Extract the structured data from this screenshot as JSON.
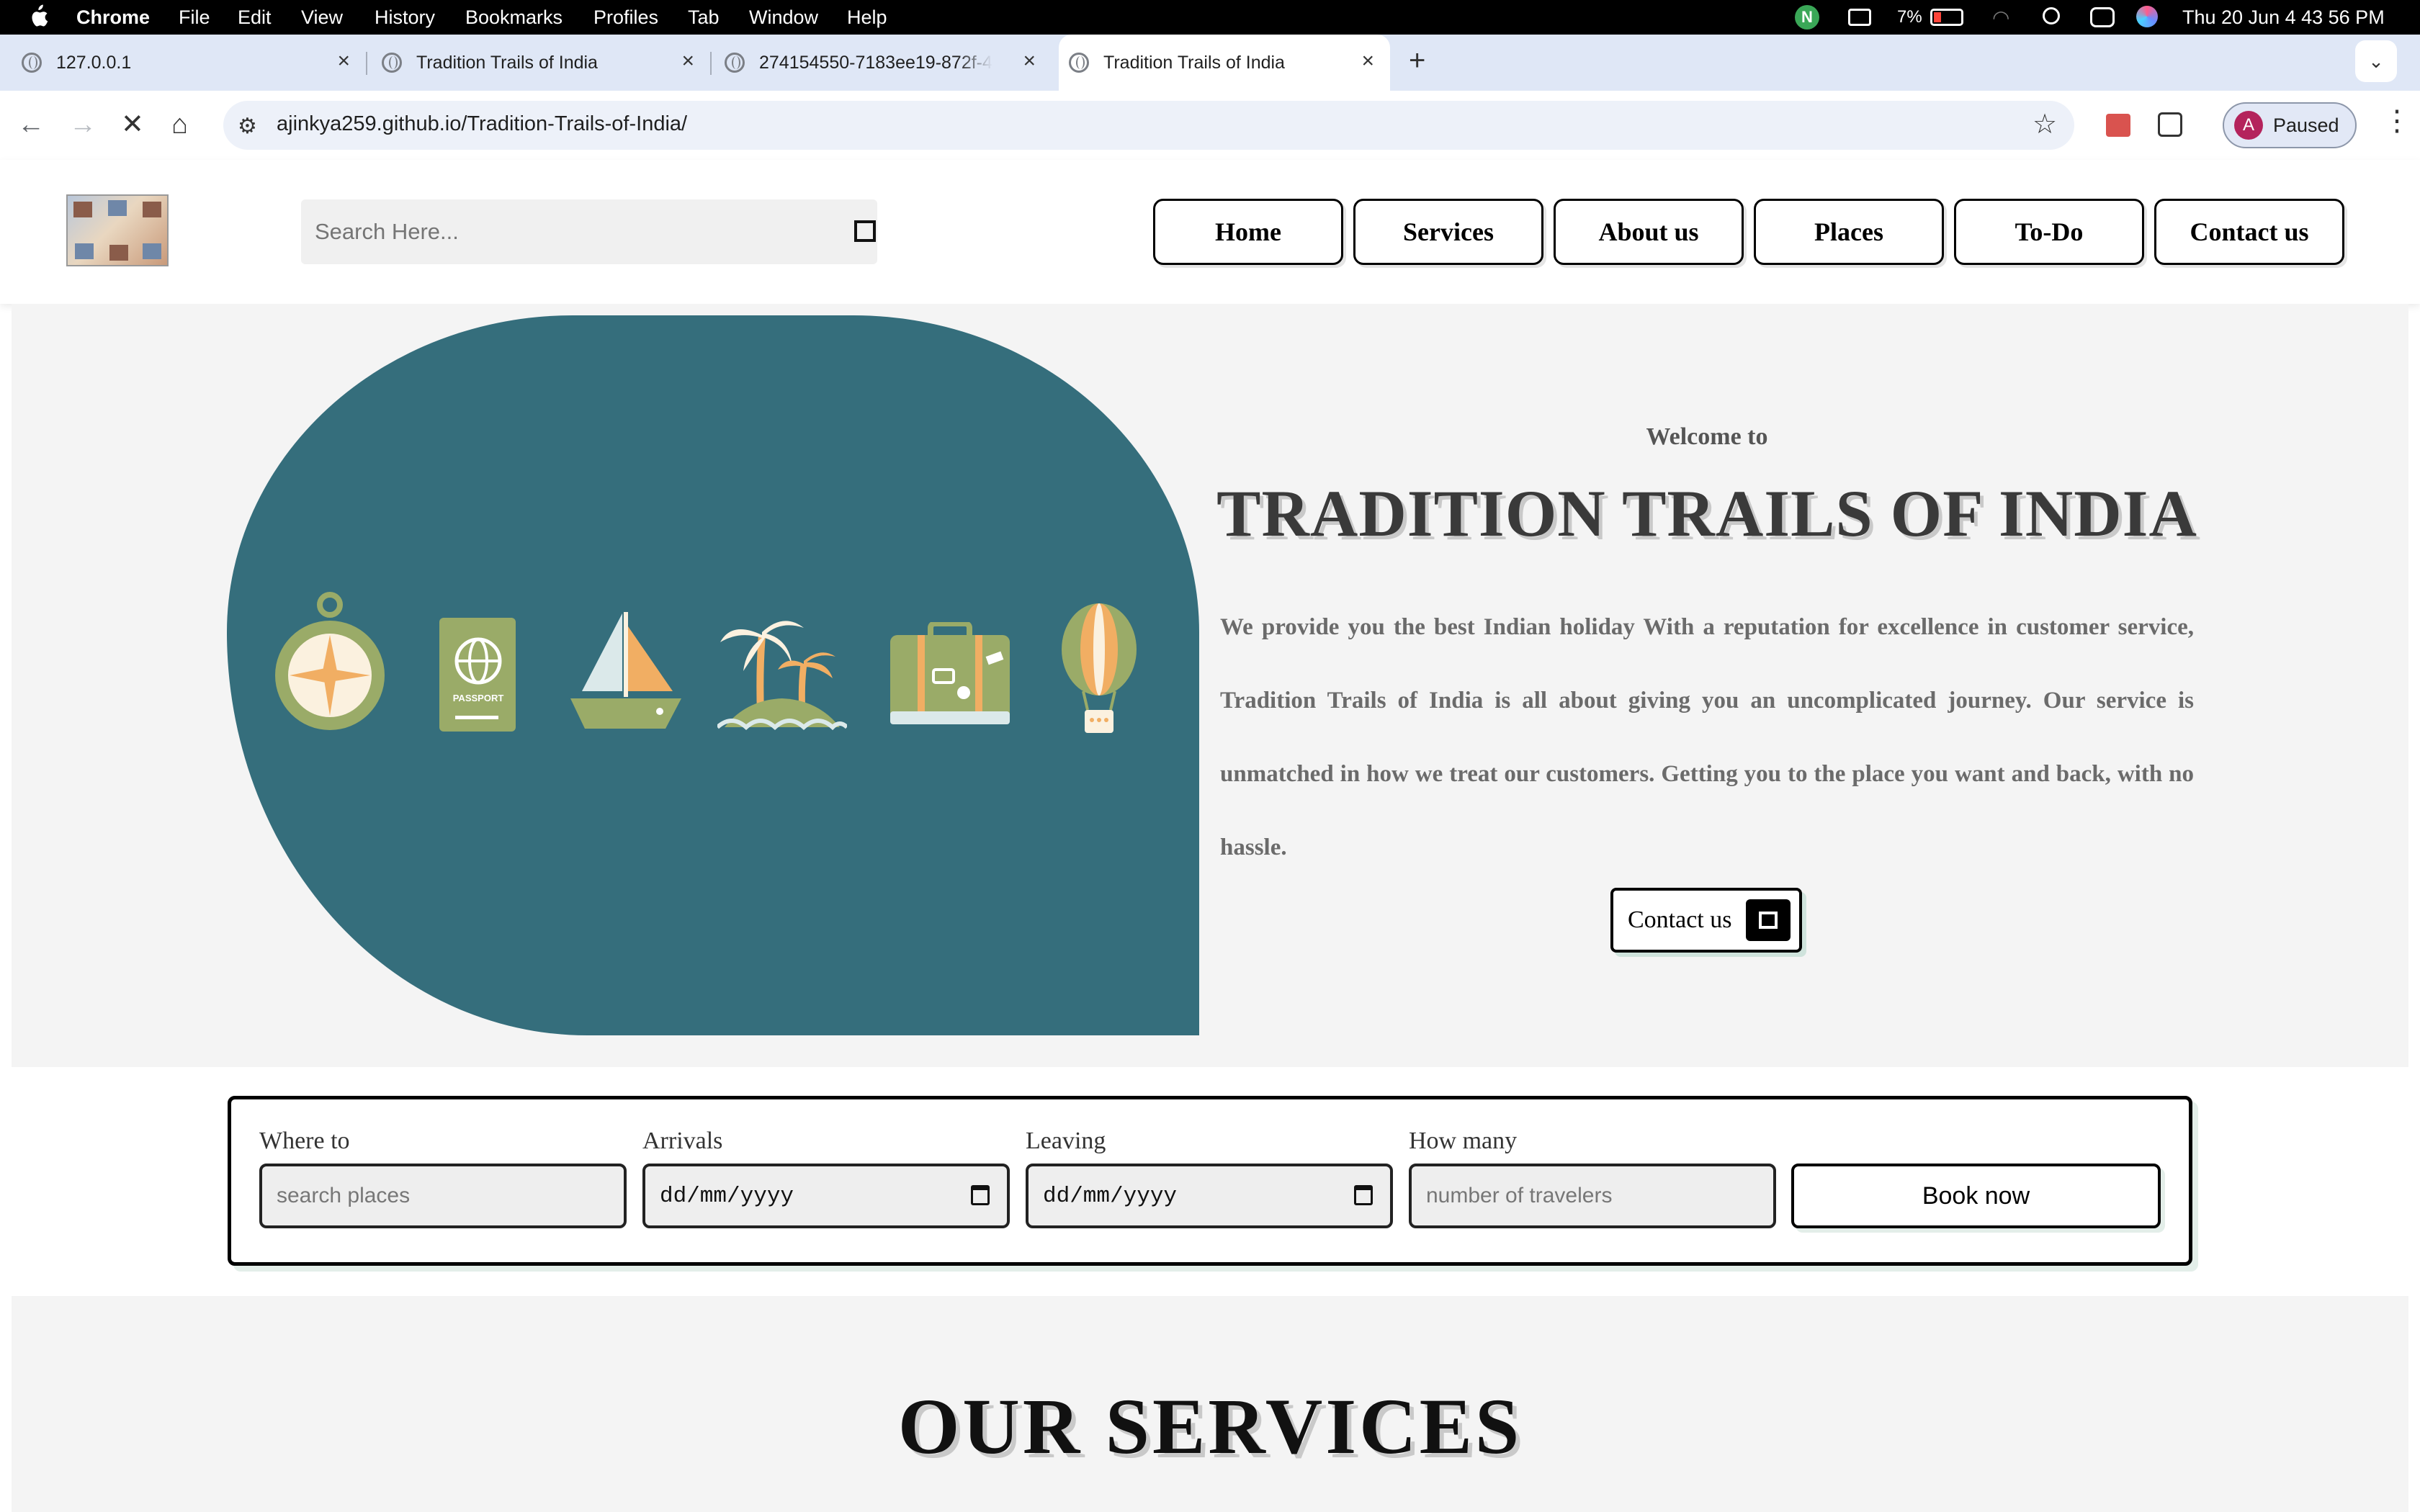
{
  "menubar": {
    "app": "Chrome",
    "items": [
      "File",
      "Edit",
      "View",
      "History",
      "Bookmarks",
      "Profiles",
      "Tab",
      "Window",
      "Help"
    ],
    "battery": "7%",
    "datetime": "Thu 20 Jun  4 43 56 PM"
  },
  "tabs": [
    {
      "title": "127.0.0.1"
    },
    {
      "title": "Tradition Trails of India"
    },
    {
      "title": "274154550-7183ee19-872f-4"
    },
    {
      "title": "Tradition Trails of India"
    }
  ],
  "toolbar": {
    "url": "ajinkya259.github.io/Tradition-Trails-of-India/",
    "profile_initial": "A",
    "profile_status": "Paused"
  },
  "header": {
    "search_placeholder": "Search Here...",
    "nav": [
      "Home",
      "Services",
      "About us",
      "Places",
      "To-Do",
      "Contact us"
    ]
  },
  "hero": {
    "welcome": "Welcome to",
    "title": "TRADITION TRAILS OF INDIA",
    "text": "We provide you the best Indian holiday With a reputation for excellence in customer service, Tradition Trails of India is all about giving you an uncomplicated journey. Our service is unmatched in how we treat our customers. Getting you to the place you want and back, with no hassle.",
    "cta": "Contact us",
    "passport_label": "PASSPORT",
    "icons": [
      "compass-icon",
      "passport-icon",
      "sailboat-icon",
      "island-icon",
      "suitcase-icon",
      "hot-air-balloon-icon"
    ],
    "colors": {
      "blob": "#356e7c",
      "green": "#9aab68",
      "orange": "#f1ae63"
    }
  },
  "booking": {
    "where_label": "Where to",
    "where_placeholder": "search places",
    "arrivals_label": "Arrivals",
    "arrivals_value": "dd/mm/yyyy",
    "leaving_label": "Leaving",
    "leaving_value": "dd/mm/yyyy",
    "howmany_label": "How many",
    "howmany_placeholder": "number of travelers",
    "button": "Book now"
  },
  "services": {
    "title": "OUR SERVICES"
  }
}
